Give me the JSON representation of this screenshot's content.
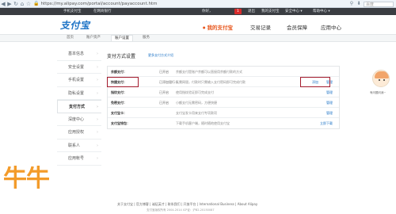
{
  "browser": {
    "url": "https://my.alipay.com/portal/account/payaccount.htm",
    "search_placeholder": "百度"
  },
  "topbar": {
    "left_items": [
      "手机支付宝",
      "在网商银行"
    ],
    "user_label": "你好，",
    "badge": "1",
    "links": [
      "退出",
      "我的支付宝",
      "安全中心 ▾",
      "帮助中心 ▾"
    ]
  },
  "header": {
    "logo": "支付宝",
    "nav": [
      "我的支付宝",
      "交易记录",
      "会员保障",
      "应用中心"
    ]
  },
  "subtabs": [
    "首页",
    "账户资产",
    "账户设置",
    "服务"
  ],
  "sidebar": {
    "items": [
      "基本信息",
      "安全设置",
      "手机设置",
      "隐私设置",
      "支付方式",
      "深度中心",
      "应用授权",
      "联系人",
      "应用帐号"
    ]
  },
  "panel": {
    "title": "支付方式设置",
    "subtitle": "更多支付方式介绍",
    "rows": [
      {
        "name": "余额支付：",
        "status": "已开启",
        "desc": "余额支付是账户余额可以直接用余额付款的方式",
        "action": "",
        "action2": ""
      },
      {
        "name": "快捷支付：",
        "status": "已添加银行卡",
        "desc": "无需网银，付款时只需输入支付密码即可完成付款",
        "action": "管理",
        "action2": "添加"
      },
      {
        "name": "指纹支付：",
        "status": "已开启",
        "desc": "使用指纹验证即可完成支付",
        "action": "管理",
        "action2": ""
      },
      {
        "name": "免密支付：",
        "status": "已开启",
        "desc": "小额支付无需密码，方便快捷",
        "action": "管理",
        "action2": ""
      },
      {
        "name": "支付宝卡：",
        "status": "",
        "desc": "支付宝发卡用来支付专项款项",
        "action": "管理",
        "action2": ""
      },
      {
        "name": "支付宝钱包：",
        "status": "",
        "desc": "下载手机客户端，随时随地使用支付宝",
        "action": "立即下载",
        "action2": ""
      }
    ]
  },
  "footer": {
    "links": "关于支付宝 | 官方博客 | 诚征英才 | 联系我们 | 开放平台 | International Business | About Alipay",
    "copy": "支付宝版权所有 2004-2014 ICP证：沪B2-20150087"
  },
  "widget": {
    "label": "有问题问我~"
  },
  "watermark": {
    "text": "牛牛"
  }
}
